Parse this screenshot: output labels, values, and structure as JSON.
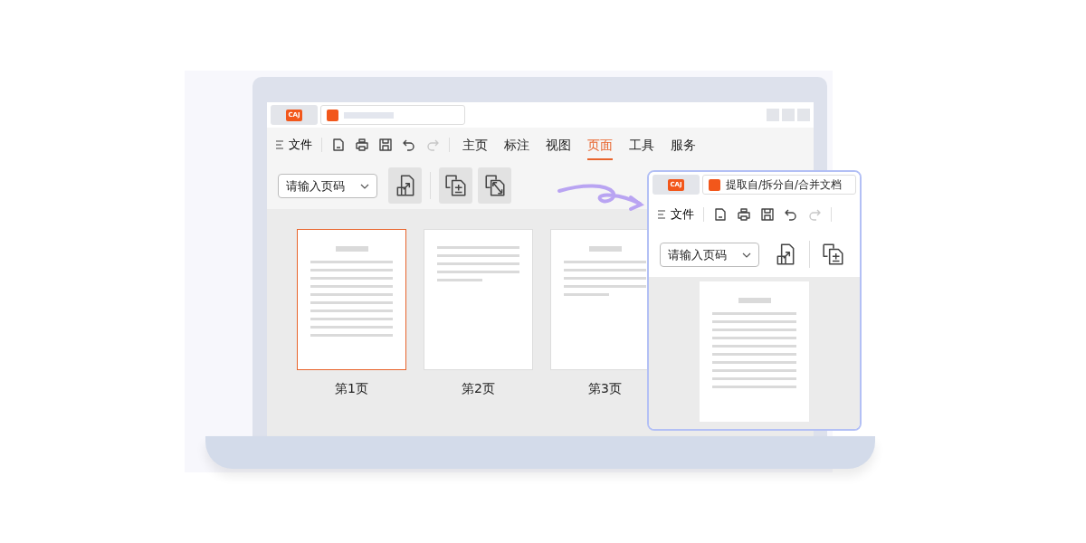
{
  "main_window": {
    "tabs": [
      {
        "kind": "logo",
        "label": "CAJ",
        "selected": false
      },
      {
        "kind": "document",
        "selected": true
      }
    ],
    "menu_label": "文件",
    "quick_tools": [
      {
        "kind": "open",
        "disabled": false
      },
      {
        "kind": "print",
        "disabled": false
      },
      {
        "kind": "save",
        "disabled": false
      },
      {
        "kind": "undo",
        "disabled": false
      },
      {
        "kind": "redo",
        "disabled": true
      }
    ],
    "ribbon_tabs": [
      {
        "label": "主页",
        "selected": false
      },
      {
        "label": "标注",
        "selected": false
      },
      {
        "label": "视图",
        "selected": false
      },
      {
        "label": "页面",
        "selected": true
      },
      {
        "label": "工具",
        "selected": false
      },
      {
        "label": "服务",
        "selected": false
      }
    ],
    "page_select": {
      "placeholder": "请输入页码"
    },
    "page_tools": [
      {
        "kind": "extract"
      },
      {
        "kind": "separator"
      },
      {
        "kind": "merge"
      },
      {
        "kind": "split"
      }
    ],
    "pages": [
      {
        "label": "第1页",
        "selected": true,
        "kind": "titled-long"
      },
      {
        "label": "第2页",
        "selected": false,
        "kind": "plain-short"
      },
      {
        "label": "第3页",
        "selected": false,
        "kind": "titled-short"
      }
    ]
  },
  "popup_window": {
    "tabs": [
      {
        "kind": "logo",
        "label": "CAJ",
        "selected": false
      },
      {
        "kind": "document",
        "label": "提取自/拆分自/合并文档",
        "selected": true
      }
    ],
    "menu_label": "文件",
    "quick_tools": [
      {
        "kind": "open",
        "disabled": false
      },
      {
        "kind": "print",
        "disabled": false
      },
      {
        "kind": "save",
        "disabled": false
      },
      {
        "kind": "undo",
        "disabled": false
      },
      {
        "kind": "redo",
        "disabled": true
      }
    ],
    "page_select": {
      "placeholder": "请输入页码"
    },
    "page_tools": [
      {
        "kind": "extract"
      },
      {
        "kind": "separator"
      },
      {
        "kind": "merge"
      }
    ],
    "pages": [
      {
        "kind": "titled-long"
      }
    ]
  }
}
